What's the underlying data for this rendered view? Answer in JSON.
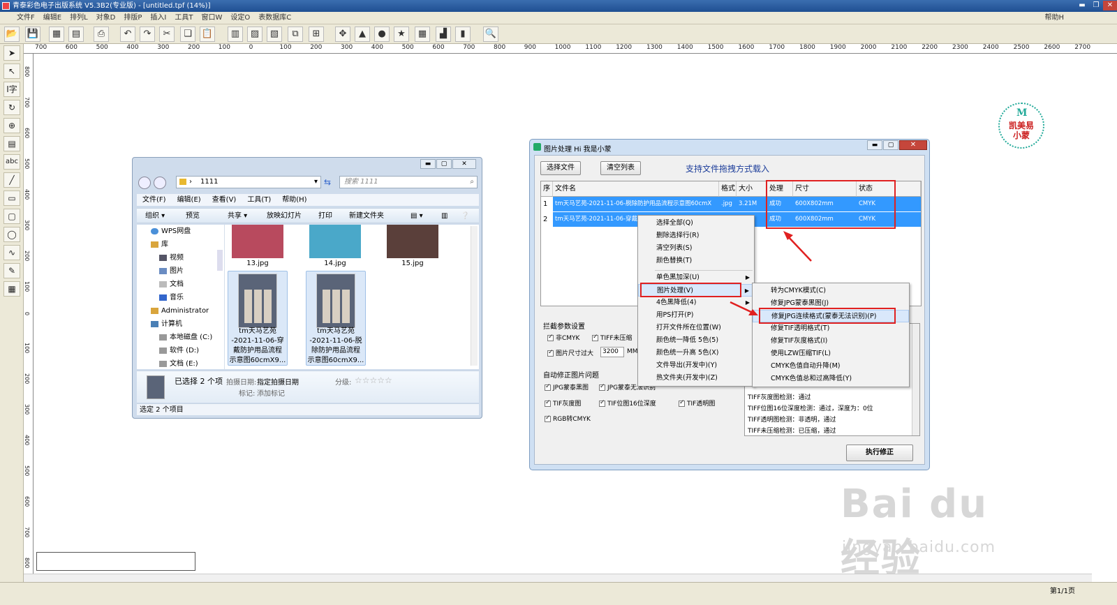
{
  "app": {
    "title": "青泰彩色电子出版系统 V5.3B2(专业版) - [untitled.tpf (14%)]",
    "menu": [
      "文件F",
      "编辑E",
      "排列L",
      "对象D",
      "排版P",
      "插入I",
      "工具T",
      "窗口W",
      "设定O",
      "表数据库C"
    ],
    "help": "帮助H",
    "page_indicator": "第1/1页"
  },
  "ruler": {
    "h_ticks": [
      "700",
      "600",
      "500",
      "400",
      "300",
      "200",
      "100",
      "0",
      "100",
      "200",
      "300",
      "400",
      "500",
      "600",
      "700",
      "800",
      "900",
      "1000",
      "1100",
      "1200",
      "1300",
      "1400",
      "1500",
      "1600",
      "1700",
      "1800",
      "1900",
      "2000",
      "2100",
      "2200",
      "2300",
      "2400",
      "2500",
      "2600",
      "2700"
    ],
    "v_ticks": [
      "800",
      "700",
      "600",
      "500",
      "400",
      "300",
      "200",
      "100",
      "0",
      "100",
      "200",
      "300",
      "400",
      "500",
      "600",
      "700",
      "800"
    ]
  },
  "logo": {
    "text_top": "凯美易",
    "text_bottom": "小蒙"
  },
  "explorer": {
    "address": "1111",
    "search_placeholder": "搜索 1111",
    "menu": [
      "文件(F)",
      "编辑(E)",
      "查看(V)",
      "工具(T)",
      "帮助(H)"
    ],
    "commands": [
      "组织 ▾",
      "预览",
      "共享 ▾",
      "放映幻灯片",
      "打印",
      "新建文件夹"
    ],
    "nav": [
      "WPS网盘",
      "库",
      "视频",
      "图片",
      "文档",
      "音乐",
      "Administrator",
      "计算机",
      "本地磁盘 (C:)",
      "软件 (D:)",
      "文档 (E:)"
    ],
    "files": [
      {
        "name": "13.jpg",
        "color": "#b84a5e"
      },
      {
        "name": "14.jpg",
        "color": "#4aa8c9"
      },
      {
        "name": "15.jpg",
        "color": "#5a3f3a"
      }
    ],
    "selected_files": [
      {
        "name_lines": [
          "tm天马艺苑",
          "-2021-11-06-穿",
          "戴防护用品流程",
          "示意图60cmX9..."
        ]
      },
      {
        "name_lines": [
          "tm天马艺苑",
          "-2021-11-06-脱",
          "除防护用品流程",
          "示意图60cmX9..."
        ]
      }
    ],
    "details": {
      "selected": "已选择 2 个项",
      "date_label": "拍摄日期:",
      "date_value": "指定拍摄日期",
      "tag_label": "标记:",
      "tag_value": "添加标记",
      "rating_label": "分级:",
      "stars": "☆☆☆☆☆"
    },
    "status": "选定 2 个项目"
  },
  "imgproc": {
    "title": "图片处理   Hi 我是小蒙",
    "btn_select": "选择文件",
    "btn_clear": "清空列表",
    "hint": "支持文件拖拽方式载入",
    "columns": [
      "序",
      "文件名",
      "格式",
      "大小",
      "处理",
      "尺寸",
      "状态"
    ],
    "rows": [
      {
        "idx": "1",
        "name": "tm天马艺苑-2021-11-06-脱除防护用品流程示意图60cmX",
        "fmt": ".jpg",
        "size": "3.21M",
        "proc": "成功",
        "dim": "600X802mm",
        "status": "CMYK"
      },
      {
        "idx": "2",
        "name": "tm天马艺苑-2021-11-06-穿戴",
        "fmt": "",
        "size": "",
        "proc": "成功",
        "dim": "600X802mm",
        "status": "CMYK"
      }
    ],
    "settings_label": "拦截参数设置",
    "settings": {
      "non_cmyk": "非CMYK",
      "tiff_uncompressed": "TIFF未压缩",
      "oversize": "图片尺寸过大",
      "oversize_value": "3200",
      "oversize_unit": "MM"
    },
    "fix_label": "自动修正图片问题",
    "fix": {
      "jpg_black": "JPG蒙泰黑图",
      "jpg_unrecognized": "JPG蒙泰无法识别",
      "tif_gray": "TIF灰度图",
      "tif_16bit": "TIF位图16位深度",
      "tif_transparent": "TIF透明图",
      "rgb_to_cmyk": "RGB转CMYK"
    },
    "log": [
      "TIFF灰度图检测：通过",
      "TIFF位图16位深度检测：通过，深度为：0位",
      "TIFF透明图检测：非透明，通过",
      "TIFF未压缩检测：已压缩，通过"
    ],
    "btn_execute": "执行修正"
  },
  "context_menu": [
    "选择全部(Q)",
    "删除选择行(R)",
    "清空列表(S)",
    "颜色替换(T)",
    "单色黑加深(U)",
    "图片处理(V)",
    "4色黑降低(4)",
    "用PS打开(P)",
    "打开文件所在位置(W)",
    "颜色统一降低 5色(5)",
    "颜色统一升高 5色(X)",
    "文件导出(开发中)(Y)",
    "热文件夹(开发中)(Z)"
  ],
  "submenu": [
    "转为CMYK模式(C)",
    "修复JPG蒙泰黑图(J)",
    "修复JPG连续格式(蒙泰无法识别)(P)",
    "修复TIF透明格式(T)",
    "修复TIF灰度格式(I)",
    "使用LZW压缩TIF(L)",
    "CMYK色值自动升降(M)",
    "CMYK色值总和过高降低(Y)"
  ],
  "watermark": {
    "big": "Bai du 经验",
    "small": "jingyan.baidu.com"
  },
  "colors": {
    "accent_red": "#e02020",
    "selection_blue": "#3399ff",
    "hint_blue": "#1c3d9a"
  }
}
